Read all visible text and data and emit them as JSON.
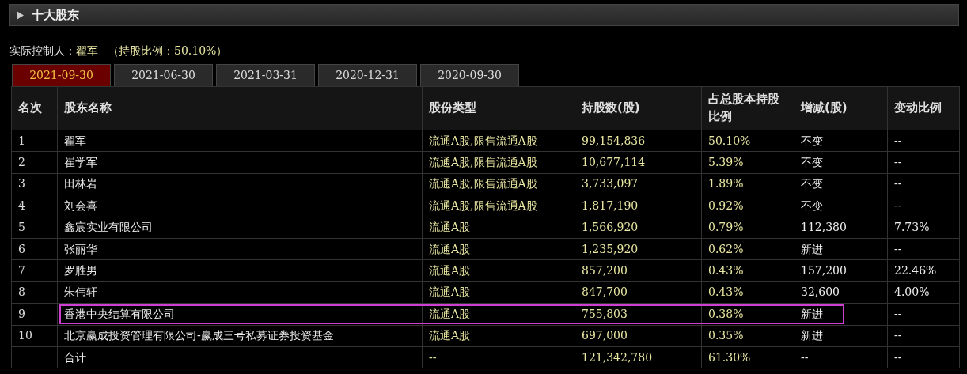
{
  "section": {
    "title": "十大股东",
    "expanded": false
  },
  "controller": {
    "label": "实际控制人：",
    "name": "翟军",
    "ratio": "（持股比例：50.10%）"
  },
  "tabs": [
    {
      "label": "2021-09-30",
      "selected": true
    },
    {
      "label": "2021-06-30",
      "selected": false
    },
    {
      "label": "2021-03-31",
      "selected": false
    },
    {
      "label": "2020-12-31",
      "selected": false
    },
    {
      "label": "2020-09-30",
      "selected": false
    }
  ],
  "table": {
    "columns": [
      "名次",
      "股东名称",
      "股份类型",
      "持股数(股)",
      "占总股本持股比例",
      "增减(股)",
      "变动比例"
    ],
    "rows": [
      {
        "cells": [
          "1",
          "翟军",
          "流通A股,限售流通A股",
          "99,154,836",
          "50.10%",
          "不变",
          "--"
        ],
        "annotated": false
      },
      {
        "cells": [
          "2",
          "崔学军",
          "流通A股,限售流通A股",
          "10,677,114",
          "5.39%",
          "不变",
          "--"
        ],
        "annotated": false
      },
      {
        "cells": [
          "3",
          "田林岩",
          "流通A股,限售流通A股",
          "3,733,097",
          "1.89%",
          "不变",
          "--"
        ],
        "annotated": false
      },
      {
        "cells": [
          "4",
          "刘会喜",
          "流通A股,限售流通A股",
          "1,817,190",
          "0.92%",
          "不变",
          "--"
        ],
        "annotated": false
      },
      {
        "cells": [
          "5",
          "鑫宸实业有限公司",
          "流通A股",
          "1,566,920",
          "0.79%",
          "112,380",
          "7.73%"
        ],
        "annotated": false
      },
      {
        "cells": [
          "6",
          "张丽华",
          "流通A股",
          "1,235,920",
          "0.62%",
          "新进",
          "--"
        ],
        "annotated": false
      },
      {
        "cells": [
          "7",
          "罗胜男",
          "流通A股",
          "857,200",
          "0.43%",
          "157,200",
          "22.46%"
        ],
        "annotated": false
      },
      {
        "cells": [
          "8",
          "朱伟轩",
          "流通A股",
          "847,700",
          "0.43%",
          "32,600",
          "4.00%"
        ],
        "annotated": false
      },
      {
        "cells": [
          "9",
          "香港中央结算有限公司",
          "流通A股",
          "755,803",
          "0.38%",
          "新进",
          "--"
        ],
        "annotated": true
      },
      {
        "cells": [
          "10",
          "北京赢成投资管理有限公司-赢成三号私募证券投资基金",
          "流通A股",
          "697,000",
          "0.35%",
          "新进",
          "--"
        ],
        "annotated": false
      },
      {
        "cells": [
          "",
          "合计",
          "--",
          "121,342,780",
          "61.30%",
          "--",
          "--"
        ],
        "annotated": false
      }
    ]
  }
}
